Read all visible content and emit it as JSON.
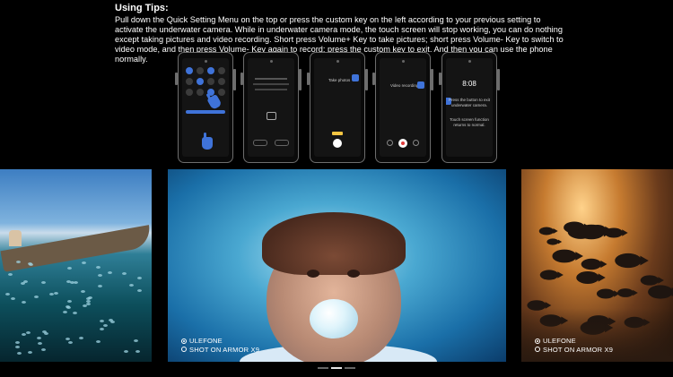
{
  "tips": {
    "title": "Using Tips:",
    "body": "Pull down the Quick Setting Menu on the top or press the custom key on the left according to your previous setting to activate the underwater camera. While in underwater camera mode, the touch screen will stop working, you can do nothing except taking pictures and video recording. Short press Volume+ Key to take pictures; short press Volume- Key to switch to video mode, and then press Volume- Key again to record; press the custom key to exit. And then you can use the phone normally."
  },
  "phones": [
    {
      "caption": ""
    },
    {
      "caption": ""
    },
    {
      "caption": "Take photos"
    },
    {
      "caption": "Video recording"
    },
    {
      "caption": "8:08",
      "sub1": "Press the button to exit underwater camera.",
      "sub2": "Touch screen function returns to normal."
    }
  ],
  "watermarks": {
    "brand": "ULEFONE",
    "shot": "SHOT ON ARMOR X9"
  },
  "carousel": {
    "total": 3,
    "active": 1
  },
  "colors": {
    "accent": "#3f73d9",
    "background": "#000000"
  }
}
